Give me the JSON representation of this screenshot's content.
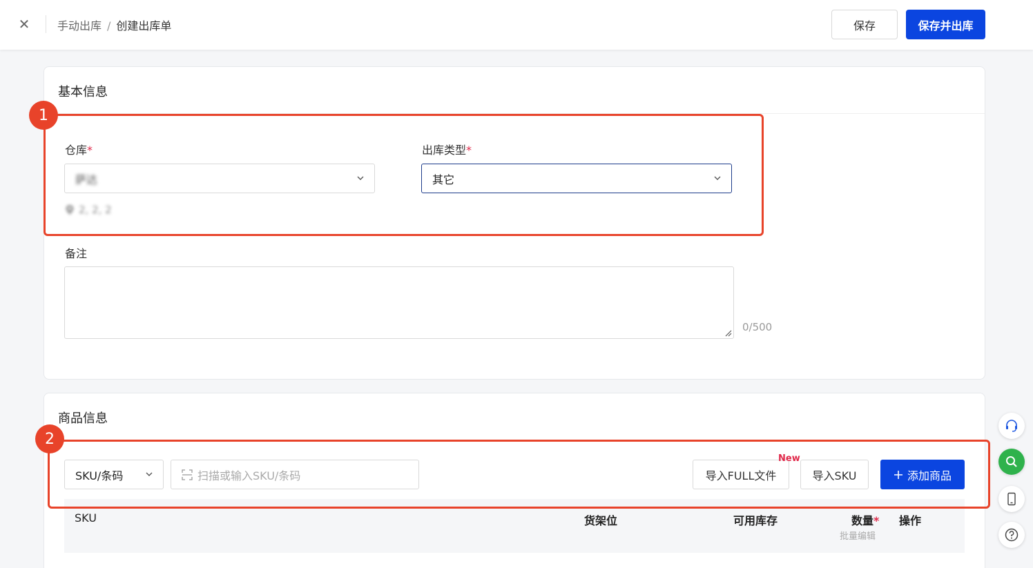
{
  "header": {
    "breadcrumb_parent": "手动出库",
    "breadcrumb_sep": "/",
    "breadcrumb_current": "创建出库单",
    "save_label": "保存",
    "save_and_out_label": "保存并出库"
  },
  "basic_info": {
    "title": "基本信息",
    "warehouse_label": "仓库",
    "warehouse_value": "萨达",
    "warehouse_address": "2, 2, 2",
    "out_type_label": "出库类型",
    "out_type_value": "其它",
    "required_mark": "*",
    "remark_label": "备注",
    "remark_value": "",
    "remark_counter": "0/500"
  },
  "goods_info": {
    "title": "商品信息",
    "search_type_value": "SKU/条码",
    "search_placeholder": "扫描或输入SKU/条码",
    "import_full_label": "导入FULL文件",
    "new_tag": "New",
    "import_sku_label": "导入SKU",
    "add_goods_label": "添加商品",
    "columns": {
      "sku": "SKU",
      "shelf": "货架位",
      "available": "可用库存",
      "quantity": "数量",
      "quantity_sub": "批量编辑",
      "action": "操作"
    }
  },
  "annotations": {
    "badge_1": "1",
    "badge_2": "2"
  },
  "colors": {
    "primary": "#0b45e0",
    "highlight": "#e8432a",
    "required": "#e0294a",
    "float_green": "#2fb24c"
  }
}
